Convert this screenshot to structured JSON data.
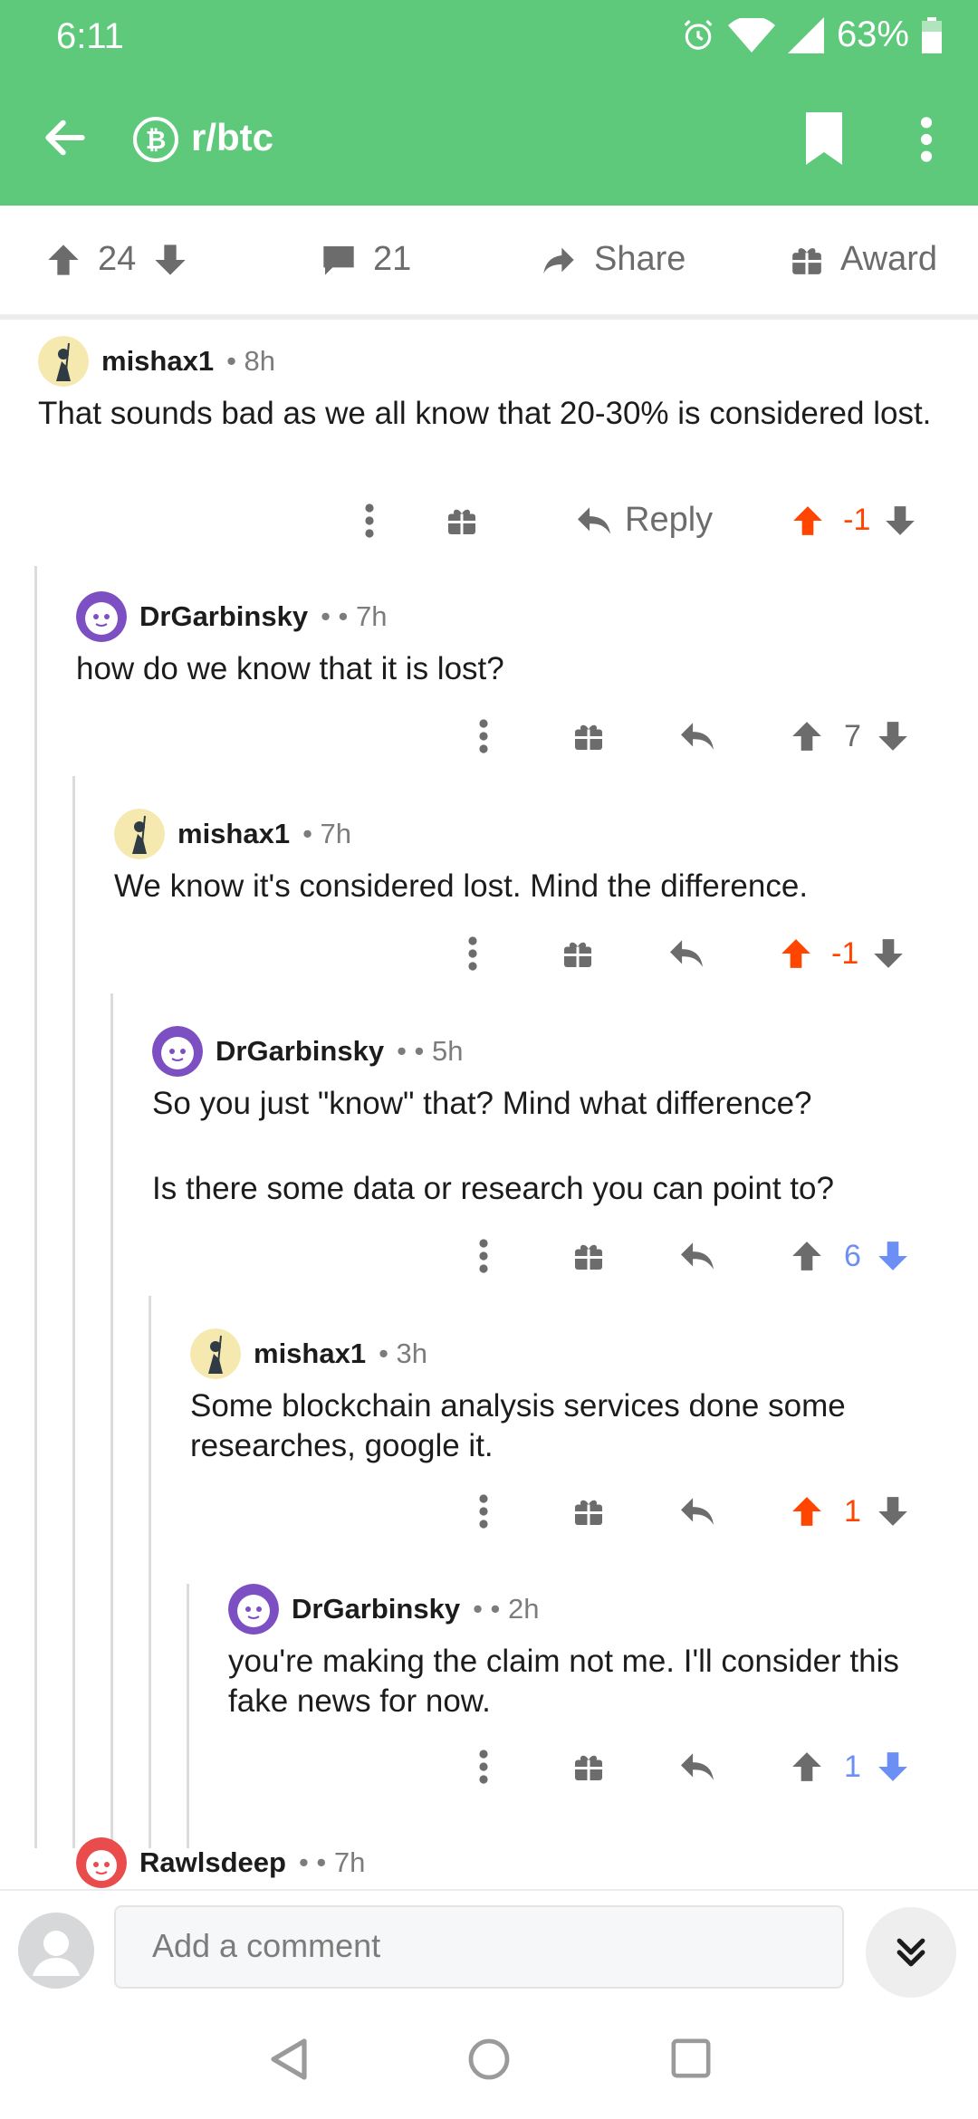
{
  "status_bar": {
    "time": "6:11",
    "battery": "63%"
  },
  "toolbar": {
    "subreddit": "r/btc"
  },
  "post_actions": {
    "score": "24",
    "comments": "21",
    "share_label": "Share",
    "award_label": "Award"
  },
  "comments": [
    {
      "author": "mishax1",
      "meta": "• 8h",
      "body": "That sounds bad as we all know that 20-30% is considered lost.",
      "score": "-1",
      "vote": "up",
      "reply_label": "Reply"
    },
    {
      "author": "DrGarbinsky",
      "meta": "• • 7h",
      "body": "how do we know that it is lost?",
      "score": "7",
      "vote": "none"
    },
    {
      "author": "mishax1",
      "meta": "• 7h",
      "body": "We know it's considered lost. Mind the difference.",
      "score": "-1",
      "vote": "up"
    },
    {
      "author": "DrGarbinsky",
      "meta": "• • 5h",
      "body": "So you just \"know\" that? Mind what difference?",
      "body2": "Is there some data or research you can point to?",
      "score": "6",
      "vote": "down"
    },
    {
      "author": "mishax1",
      "meta": "• 3h",
      "body": "Some blockchain analysis services done some researches, google it.",
      "score": "1",
      "vote": "up"
    },
    {
      "author": "DrGarbinsky",
      "meta": "• • 2h",
      "body": "you're making the claim not me. I'll consider this fake news for now.",
      "score": "1",
      "vote": "down"
    },
    {
      "author": "Rawlsdeep",
      "meta": "• • 7h"
    }
  ],
  "comment_bar": {
    "placeholder": "Add a comment"
  },
  "colors": {
    "header": "#5ec97a",
    "upvote": "#ff4500",
    "downvote": "#6b8ff5",
    "neutral": "#6c6c6c"
  }
}
